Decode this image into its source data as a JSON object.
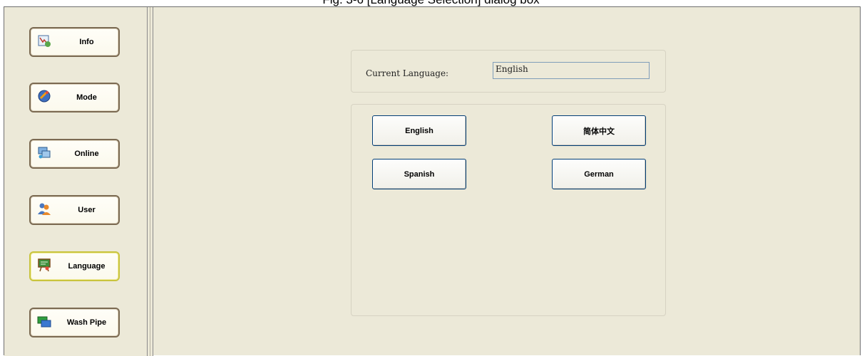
{
  "caption": "Fig. 3-6 [Language Selection] dialog box",
  "sidebar": {
    "items": [
      {
        "label": "Info",
        "icon": "info-icon"
      },
      {
        "label": "Mode",
        "icon": "mode-icon"
      },
      {
        "label": "Online",
        "icon": "online-icon"
      },
      {
        "label": "User",
        "icon": "user-icon"
      },
      {
        "label": "Language",
        "icon": "language-icon",
        "selected": true
      },
      {
        "label": "Wash Pipe",
        "icon": "wash-pipe-icon"
      }
    ]
  },
  "main": {
    "current_language_label": "Current Language:",
    "current_language_value": "English",
    "languages": [
      "English",
      "简体中文",
      "Spanish",
      "German"
    ]
  },
  "colors": {
    "background": "#ece9d8",
    "button_border": "#003c74",
    "selected_border": "#c9c43e"
  }
}
